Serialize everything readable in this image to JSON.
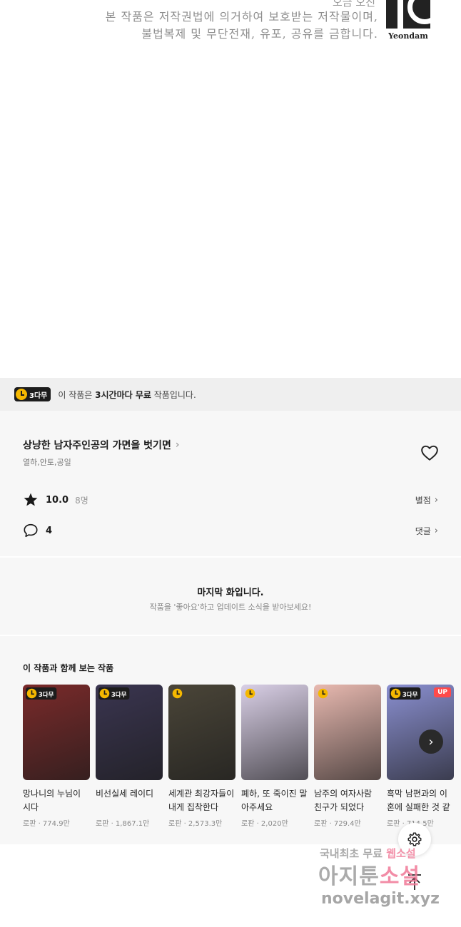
{
  "copyright": {
    "top_cut": "오금 오진",
    "line1": "본 작품은 저작권법에 의거하여 보호받는 저작물이며,",
    "line2": "불법복제 및 무단전재, 유포, 공유를 금합니다.",
    "publisher_logo": "Yeondam"
  },
  "free_bar": {
    "badge": "3다무",
    "notice_pre": "이 작품은 ",
    "notice_bold": "3시간마다 무료",
    "notice_post": " 작품입니다."
  },
  "work": {
    "title": "상냥한 남자주인공의 가면을 벗기면",
    "authors": "열하,안토,공일",
    "rating": "10.0",
    "rating_count": "8명",
    "rate_link": "별점",
    "comment_count": "4",
    "comment_link": "댓글"
  },
  "last_episode": {
    "heading": "마지막 화입니다.",
    "sub": "작품을 '좋아요'하고 업데이트 소식을 받아보세요!"
  },
  "recommendations": {
    "title": "이 작품과 함께 보는 작품",
    "items": [
      {
        "name": "망나니의 누님이 시다",
        "meta": "로판 · 774.9만",
        "badge": "3다무",
        "up": "",
        "color": "#7a2a2a"
      },
      {
        "name": "비선실세 레이디",
        "meta": "로판 · 1,867.1만",
        "badge": "3다무",
        "up": "",
        "color": "#3a3550"
      },
      {
        "name": "세계관 최강자들이 내게 집착한다",
        "meta": "로판 · 2,573.3만",
        "badge": "",
        "up": "",
        "color": "#4a4538"
      },
      {
        "name": "폐하, 또 죽이진 말아주세요",
        "meta": "로판 · 2,020만",
        "badge": "",
        "up": "",
        "color": "#d9cfe6"
      },
      {
        "name": "남주의 여자사람 친구가 되었다",
        "meta": "로판 · 729.4만",
        "badge": "",
        "up": "",
        "color": "#e8b9b0"
      },
      {
        "name": "흑막 남편과의 이혼에 실패한 것 같다",
        "meta": "로판 · 714.5만",
        "badge": "3다무",
        "up": "UP",
        "color": "#8a8fd0"
      }
    ]
  },
  "watermark": {
    "line1_a": "국내최초 무료 ",
    "line1_b": "웹소설",
    "line2_a": "아지툰",
    "line2_b": "소설",
    "line3": "novelagit.xyz"
  },
  "icons": {
    "heart": "heart-outline-icon",
    "star": "star-icon",
    "comment": "comment-bubble-icon",
    "gear": "gear-icon",
    "scroll_top": "arrow-up-to-top-icon",
    "next": "chevron-right-icon"
  }
}
